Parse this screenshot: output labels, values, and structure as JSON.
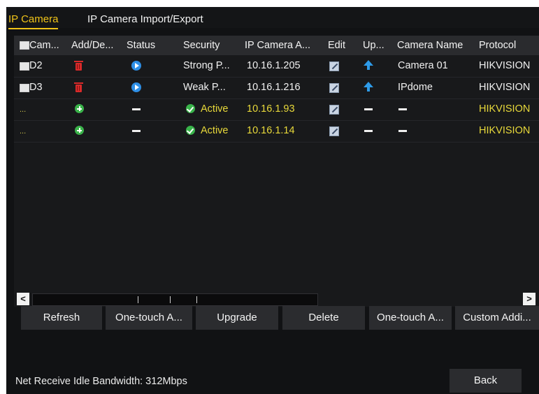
{
  "tabs": [
    {
      "label": "IP Camera",
      "active": true
    },
    {
      "label": "IP Camera Import/Export",
      "active": false
    }
  ],
  "table": {
    "headers": [
      "Cam...",
      "Add/De...",
      "Status",
      "Security",
      "IP Camera A...",
      "Edit",
      "Up...",
      "Camera Name",
      "Protocol"
    ],
    "rows": [
      {
        "cam": "D2",
        "add_icon": "delete-icon",
        "status_icon": "play-icon",
        "security": "Strong P...",
        "ip": "10.16.1.205",
        "edit_icon": "edit-icon",
        "upgrade_icon": "upgrade-arrow-icon",
        "camera_name": "Camera 01",
        "protocol": "HIKVISION"
      },
      {
        "cam": "D3",
        "add_icon": "delete-icon",
        "status_icon": "play-icon",
        "security": "Weak P...",
        "ip": "10.16.1.216",
        "edit_icon": "edit-icon",
        "upgrade_icon": "upgrade-arrow-icon",
        "camera_name": "IPdome",
        "protocol": "HIKVISION"
      },
      {
        "cam": "...",
        "add_icon": "add-icon",
        "status_icon": "dash-icon",
        "security": "Active",
        "ip": "10.16.1.93",
        "edit_icon": "edit-icon",
        "upgrade_icon": "dash-icon",
        "camera_name": "",
        "protocol": "HIKVISION"
      },
      {
        "cam": "...",
        "add_icon": "add-icon",
        "status_icon": "dash-icon",
        "security": "Active",
        "ip": "10.16.1.14",
        "edit_icon": "edit-icon",
        "upgrade_icon": "dash-icon",
        "camera_name": "",
        "protocol": "HIKVISION"
      }
    ]
  },
  "scrollbar": {
    "left_arrow": "<",
    "right_arrow": ">"
  },
  "buttons": {
    "refresh": "Refresh",
    "one_touch_activate": "One-touch A...",
    "upgrade": "Upgrade",
    "delete": "Delete",
    "one_touch_adding": "One-touch A...",
    "custom_adding": "Custom Addi..."
  },
  "footer": {
    "bandwidth": "Net Receive Idle Bandwidth: 312Mbps",
    "back": "Back"
  },
  "colors": {
    "accent": "#f0c419",
    "added_text": "#e8d93a",
    "background": "#111214"
  }
}
